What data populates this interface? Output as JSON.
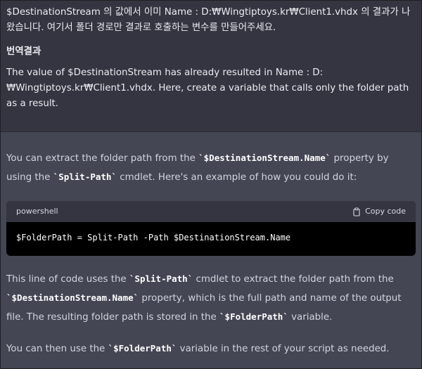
{
  "user_message": {
    "line_korean": "$DestinationStream 의 값에서 이미 Name : D:₩Wingtiptoys.kr₩Client1.vhdx 의 결과가 나왔습니다. 여기서 폴더 경로만 결과로 호출하는 변수를 만들어주세요.",
    "heading": "번역결과",
    "line_english": "The value of $DestinationStream has already resulted in Name : D:₩Wingtiptoys.kr₩Client1.vhdx. Here, create a variable that calls only the folder path as a result."
  },
  "assistant_message": {
    "p1_a": "You can extract the folder path from the ",
    "p1_code1": "`$DestinationStream.Name`",
    "p1_b": " property by using the ",
    "p1_code2": "`Split-Path`",
    "p1_c": " cmdlet. Here's an example of how you could do it:",
    "codeblock": {
      "language": "powershell",
      "copy_label": "Copy code",
      "code": "$FolderPath = Split-Path -Path $DestinationStream.Name"
    },
    "p2_a": "This line of code uses the ",
    "p2_code1": "`Split-Path`",
    "p2_b": " cmdlet to extract the folder path from the ",
    "p2_code2": "`$DestinationStream.Name`",
    "p2_c": " property, which is the full path and name of the output file. The resulting folder path is stored in the ",
    "p2_code3": "`$FolderPath`",
    "p2_d": " variable.",
    "p3_a": "You can then use the ",
    "p3_code1": "`$FolderPath`",
    "p3_b": " variable in the rest of your script as needed."
  },
  "colors": {
    "user_bg": "#343541",
    "assistant_bg": "#444654",
    "code_bg": "#000000",
    "code_header_bg": "#343541"
  },
  "icons": {
    "copy": "clipboard-icon"
  }
}
